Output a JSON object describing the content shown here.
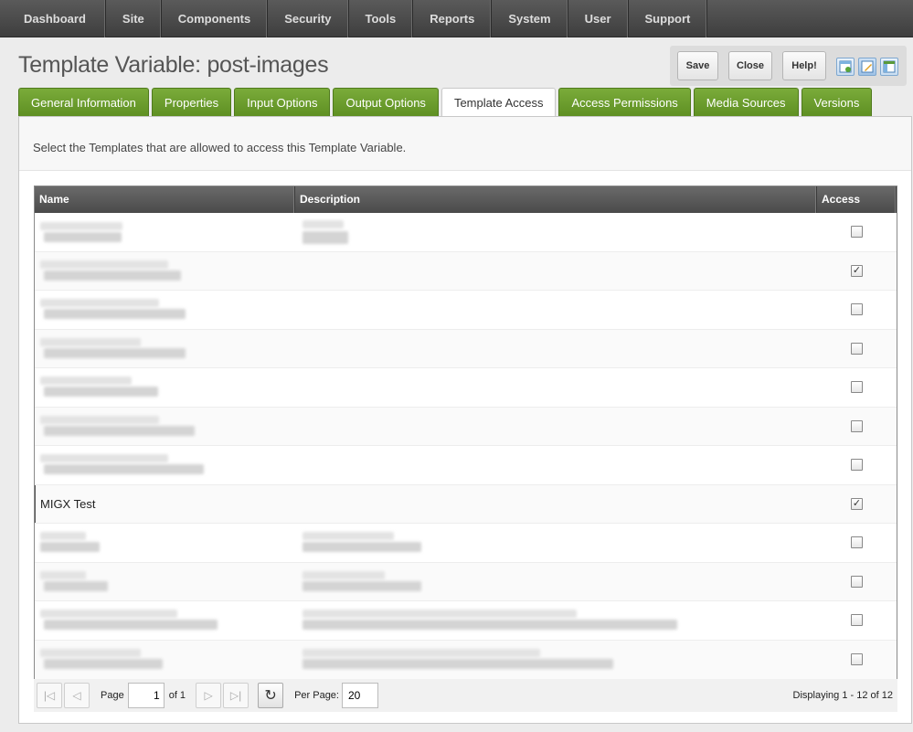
{
  "nav": [
    "Dashboard",
    "Site",
    "Components",
    "Security",
    "Tools",
    "Reports",
    "System",
    "User",
    "Support"
  ],
  "page_title": "Template Variable: post-images",
  "actions": {
    "save": "Save",
    "close": "Close",
    "help": "Help!"
  },
  "view_icons": [
    "layout-north-icon",
    "edit-icon",
    "layout-west-icon"
  ],
  "tabs": [
    "General Information",
    "Properties",
    "Input Options",
    "Output Options",
    "Template Access",
    "Access Permissions",
    "Media Sources",
    "Versions"
  ],
  "active_tab": "Template Access",
  "description": "Select the Templates that are allowed to access this Template Variable.",
  "grid": {
    "columns": {
      "name": "Name",
      "description": "Description",
      "access": "Access"
    },
    "rows": [
      {
        "name": "",
        "description": "",
        "access": false
      },
      {
        "name": "",
        "description": "",
        "access": true
      },
      {
        "name": "",
        "description": "",
        "access": false
      },
      {
        "name": "",
        "description": "",
        "access": false
      },
      {
        "name": "",
        "description": "",
        "access": false
      },
      {
        "name": "",
        "description": "",
        "access": false
      },
      {
        "name": "",
        "description": "",
        "access": false
      },
      {
        "name": "MIGX Test",
        "description": "",
        "access": true
      },
      {
        "name": "",
        "description": "",
        "access": false
      },
      {
        "name": "",
        "description": "",
        "access": false
      },
      {
        "name": "",
        "description": "",
        "access": false
      },
      {
        "name": "",
        "description": "",
        "access": false
      }
    ]
  },
  "pager": {
    "page_label": "Page",
    "page_value": "1",
    "of_label": "of 1",
    "per_page_label": "Per Page:",
    "per_page_value": "20",
    "displaying": "Displaying 1 - 12 of 12"
  }
}
